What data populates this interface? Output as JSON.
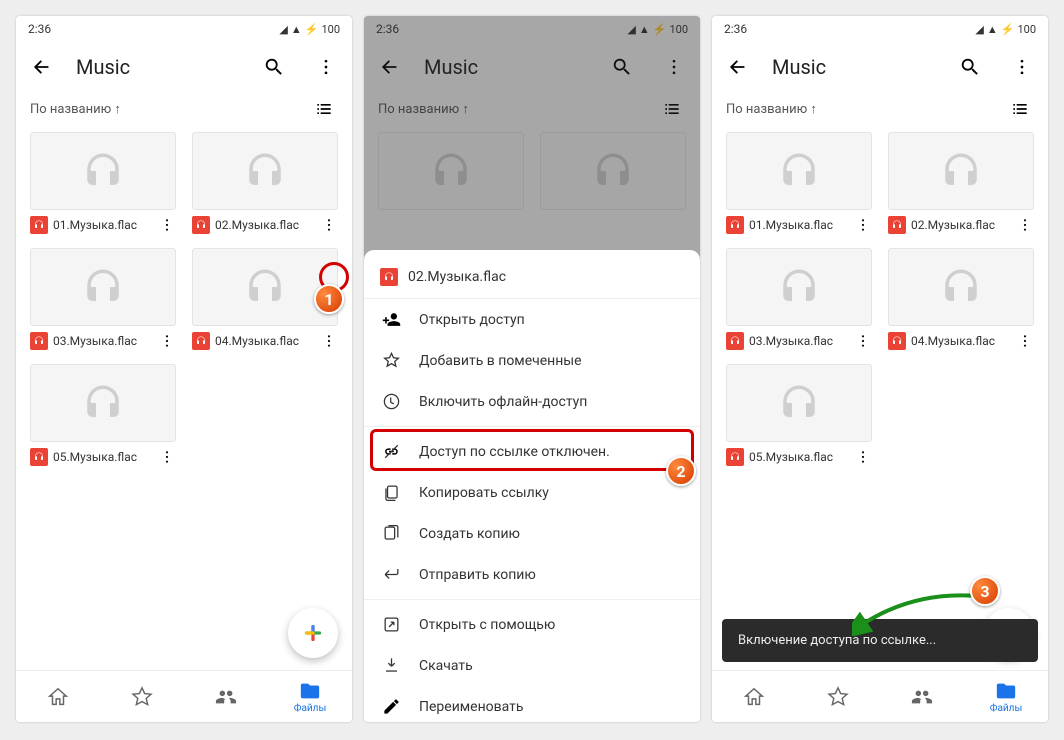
{
  "status": {
    "time": "2:36",
    "battery": "100"
  },
  "appbar": {
    "title": "Music"
  },
  "sort": {
    "label": "По названию ↑"
  },
  "files": [
    {
      "name": "01.Музыка.flac"
    },
    {
      "name": "02.Музыка.flac"
    },
    {
      "name": "03.Музыка.flac"
    },
    {
      "name": "04.Музыка.flac"
    },
    {
      "name": "05.Музыка.flac"
    }
  ],
  "nav": {
    "files_label": "Файлы"
  },
  "sheet": {
    "title": "02.Музыка.flac",
    "items": {
      "share": "Открыть доступ",
      "star": "Добавить в помеченные",
      "offline": "Включить офлайн-доступ",
      "link": "Доступ по ссылке отключен.",
      "copylink": "Копировать ссылку",
      "copy": "Создать копию",
      "send": "Отправить копию",
      "openwith": "Открыть с помощью",
      "download": "Скачать",
      "rename": "Переименовать"
    }
  },
  "toast": {
    "text": "Включение доступа по ссылке..."
  },
  "badges": {
    "b1": "1",
    "b2": "2",
    "b3": "3"
  }
}
